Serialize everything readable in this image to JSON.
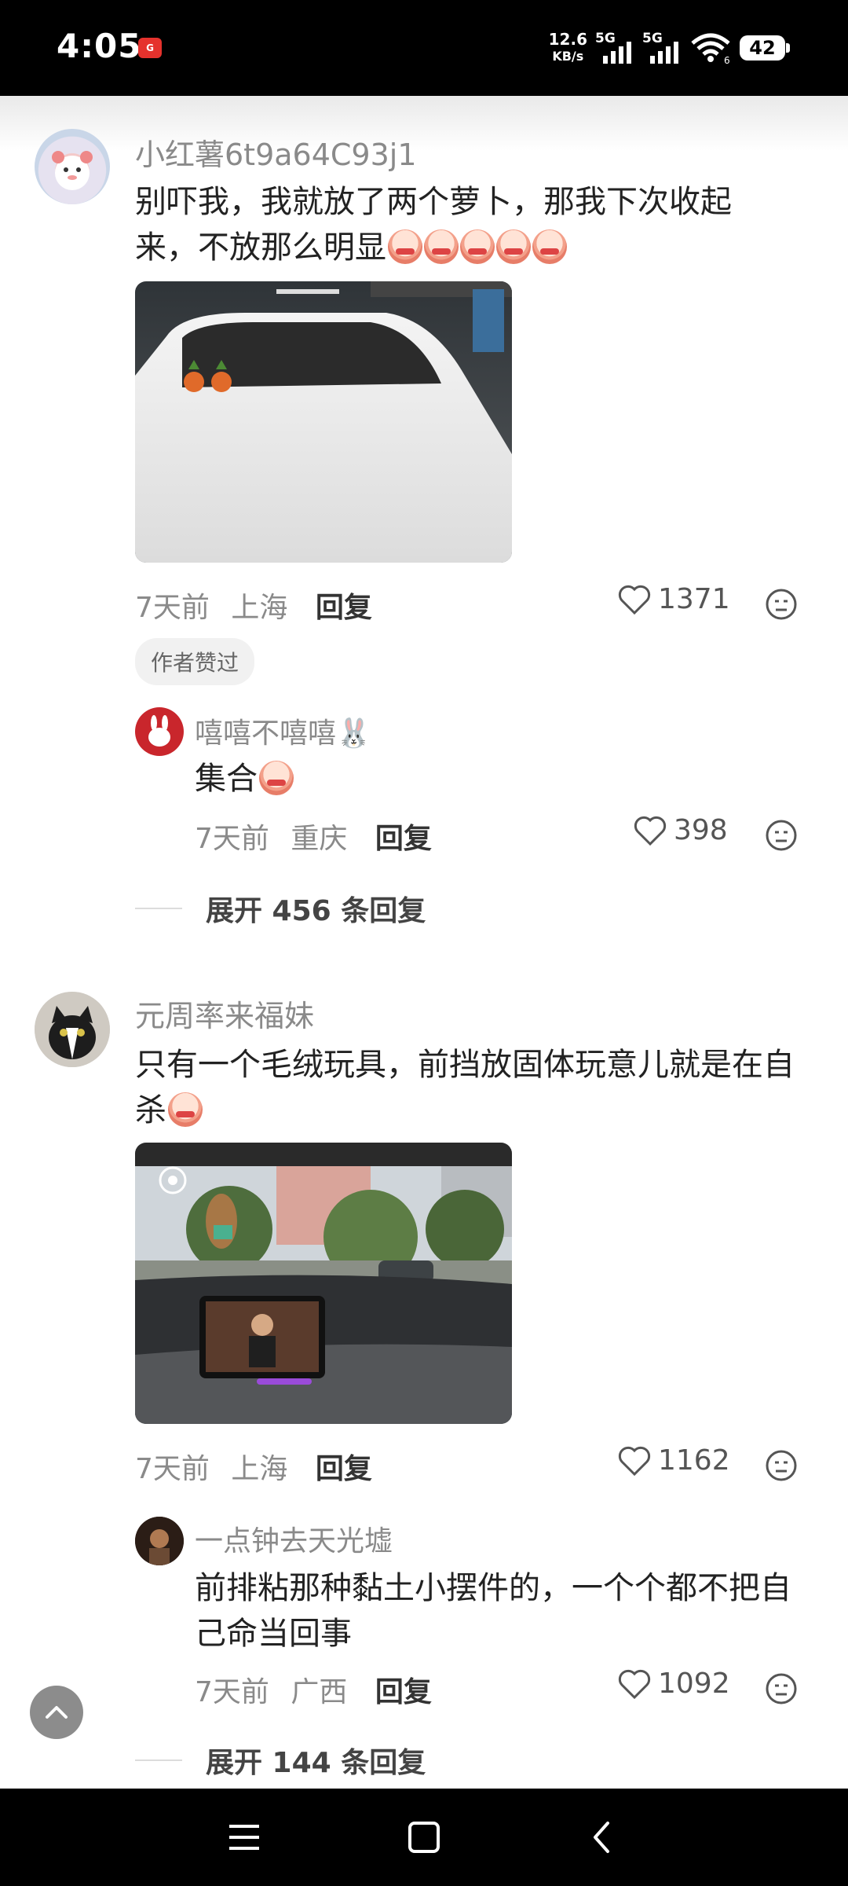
{
  "status_bar": {
    "time": "4:05",
    "net_speed": "12.6",
    "net_speed_unit": "KB/s",
    "sim1_label": "5G",
    "sim2_label": "5G",
    "wifi_label": "6",
    "battery": "42"
  },
  "comments": [
    {
      "user": "小红薯6t9a64C93j1",
      "text": "别吓我，我就放了两个萝卜，那我下次收起来，不放那么明显",
      "time": "7天前",
      "location": "上海",
      "reply_label": "回复",
      "likes": "1371",
      "badge": "作者赞过",
      "replies": [
        {
          "user": "嘻嘻不嘻嘻🐰",
          "text": "集合",
          "time": "7天前",
          "location": "重庆",
          "reply_label": "回复",
          "likes": "398"
        }
      ],
      "expand_label": "展开 456 条回复"
    },
    {
      "user": "元周率来福妹",
      "text": "只有一个毛绒玩具，前挡放固体玩意儿就是在自杀",
      "time": "7天前",
      "location": "上海",
      "reply_label": "回复",
      "likes": "1162",
      "replies": [
        {
          "user": "一点钟去天光墟",
          "text": "前排粘那种黏土小摆件的，一个个都不把自己命当回事",
          "time": "7天前",
          "location": "广西",
          "reply_label": "回复",
          "likes": "1092"
        }
      ],
      "expand_label": "展开 144 条回复"
    }
  ],
  "icons": {
    "like": "heart-outline-icon",
    "dislike": "neutral-face-icon",
    "scroll_top": "chevron-up-icon",
    "nav": [
      "menu-icon",
      "home-square-icon",
      "back-chevron-icon"
    ]
  },
  "colors": {
    "username": "#8a8a8a",
    "text": "#222222",
    "meta": "#8a8a8a",
    "status_bar": "#000000"
  }
}
